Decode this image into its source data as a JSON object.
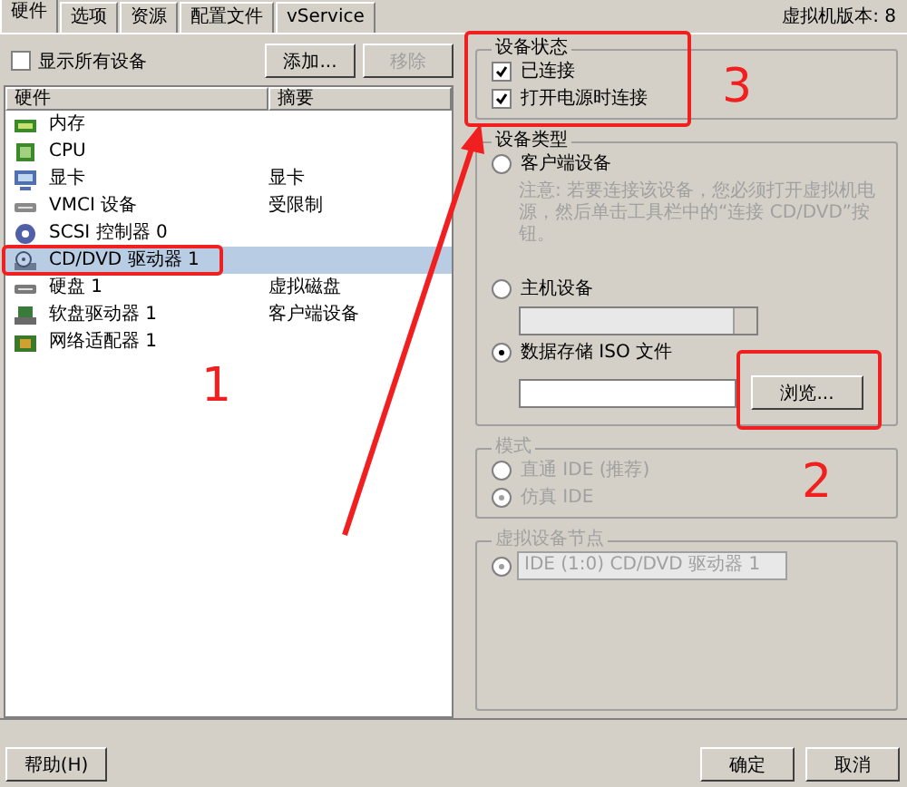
{
  "tabs": [
    {
      "label": "硬件",
      "selected": true
    },
    {
      "label": "选项",
      "selected": false
    },
    {
      "label": "资源",
      "selected": false
    },
    {
      "label": "配置文件",
      "selected": false
    },
    {
      "label": "vService",
      "selected": false
    }
  ],
  "version_label": "虚拟机版本: 8",
  "show_all": {
    "label": "显示所有设备",
    "checked": false
  },
  "list_buttons": [
    {
      "label": "添加...",
      "disabled": false
    },
    {
      "label": "移除",
      "disabled": true
    }
  ],
  "table": {
    "columns": [
      "硬件",
      "摘要"
    ],
    "rows": [
      {
        "kind": "memory",
        "name": "内存",
        "selected": false
      },
      {
        "kind": "cpu",
        "name": "CPU",
        "selected": false
      },
      {
        "kind": "display",
        "name": "显卡",
        "summary": "显卡",
        "selected": false
      },
      {
        "kind": "vmci",
        "name": "VMCI 设备",
        "summary": "受限制",
        "selected": false
      },
      {
        "kind": "scsi",
        "name": "SCSI 控制器 0",
        "selected": false
      },
      {
        "kind": "cdrom",
        "name": "CD/DVD 驱动器 1",
        "selected": true
      },
      {
        "kind": "disk",
        "name": "硬盘 1",
        "summary": "虚拟磁盘",
        "selected": false
      },
      {
        "kind": "floppy",
        "name": "软盘驱动器 1",
        "summary": "客户端设备",
        "selected": false
      },
      {
        "kind": "network",
        "name": "网络适配器 1",
        "selected": false
      }
    ]
  },
  "device_status": {
    "title": "设备状态",
    "items": [
      {
        "label": "已连接",
        "checked": true
      },
      {
        "label": "打开电源时连接",
        "checked": true
      }
    ]
  },
  "device_type": {
    "title": "设备类型",
    "options": [
      {
        "label": "客户端设备",
        "selected": false,
        "note": "注意: 若要连接该设备，您必须打开虚拟机电源，然后单击工具栏中的“连接 CD/DVD”按钮。"
      },
      {
        "label": "主机设备",
        "selected": false
      },
      {
        "label": "数据存储 ISO 文件",
        "selected": true
      }
    ],
    "browse_button": "浏览..."
  },
  "mode": {
    "title": "模式",
    "disabled": true,
    "options": [
      {
        "label": "直通 IDE (推荐)",
        "selected": false
      },
      {
        "label": "仿真 IDE",
        "selected": true
      }
    ]
  },
  "device_node": {
    "title": "虚拟设备节点",
    "disabled": true,
    "value": "IDE (1:0) CD/DVD 驱动器 1"
  },
  "footer": {
    "help": "帮助(H)",
    "ok": "确定",
    "cancel": "取消"
  },
  "annotations": [
    {
      "label": "1"
    },
    {
      "label": "2"
    },
    {
      "label": "3"
    }
  ]
}
